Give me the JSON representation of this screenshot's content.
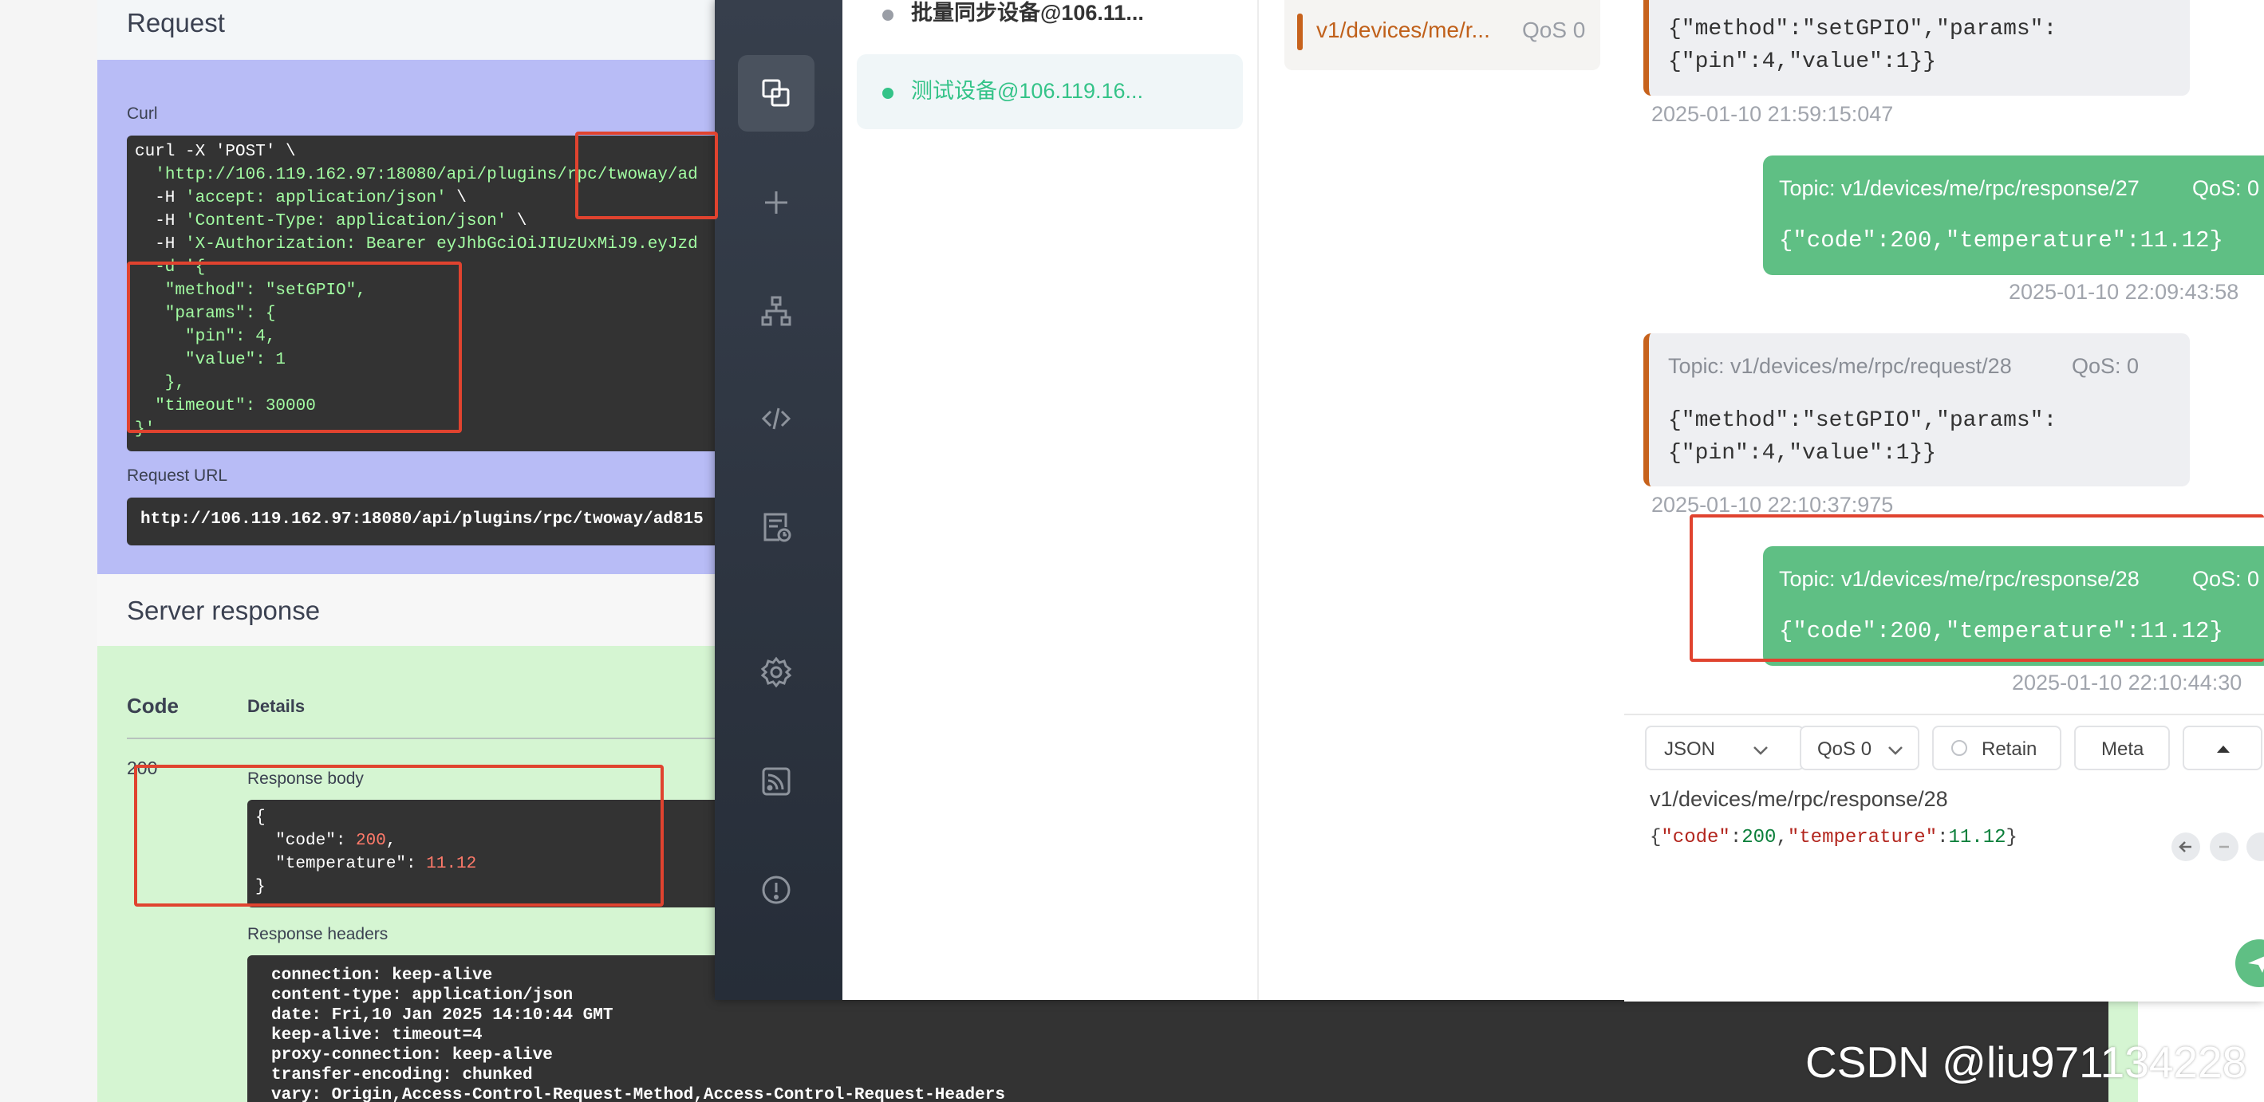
{
  "swagger": {
    "request_title": "Request",
    "curl_label": "Curl",
    "curl_lines": [
      "curl -X 'POST' \\",
      "  'http://106.119.162.97:18080/api/plugins/rpc/twoway/ad",
      "  -H 'accept: application/json' \\",
      "  -H 'Content-Type: application/json' \\",
      "  -H 'X-Authorization: Bearer eyJhbGciOiJIUzUxMiJ9.eyJzd",
      "  -d '{",
      "   \"method\": \"setGPIO\",",
      "   \"params\": {",
      "     \"pin\": 4,",
      "     \"value\": 1",
      "   },",
      "  \"timeout\": 30000",
      "}'"
    ],
    "request_url_label": "Request URL",
    "request_url": "http://106.119.162.97:18080/api/plugins/rpc/twoway/ad815",
    "server_response_title": "Server response",
    "code_header": "Code",
    "details_header": "Details",
    "code_value": "200",
    "response_body_label": "Response body",
    "response_body": {
      "open": "{",
      "code_key": "  \"code\": ",
      "code_val": "200",
      "comma": ",",
      "temp_key": "  \"temperature\": ",
      "temp_val": "11.12",
      "close": "}"
    },
    "response_headers_label": "Response headers",
    "response_headers": "connection: keep-alive\ncontent-type: application/json\ndate: Fri,10 Jan 2025 14:10:44 GMT\nkeep-alive: timeout=4\nproxy-connection: keep-alive\ntransfer-encoding: chunked\nvary: Origin,Access-Control-Request-Method,Access-Control-Request-Headers"
  },
  "mqttx": {
    "nav_icons": [
      "connections-icon",
      "plus-icon",
      "network-icon",
      "code-icon",
      "log-icon",
      "settings-icon",
      "feed-icon",
      "info-icon"
    ],
    "connections": [
      {
        "label": "批量同步设备@106.11...",
        "dot_color": "#9a9ea6",
        "text_color": "#333333"
      },
      {
        "label": "测试设备@106.119.16...",
        "dot_color": "#34c388",
        "text_color": "#34c388"
      }
    ],
    "subscription": {
      "topic": "v1/devices/me/r...",
      "qos": "QoS 0",
      "color": "#c7621c"
    },
    "messages": {
      "m1": {
        "payload": "{\"method\":\"setGPIO\",\"params\":\n{\"pin\":4,\"value\":1}}",
        "time": "2025-01-10 21:59:15:047"
      },
      "m2": {
        "topic": "Topic: v1/devices/me/rpc/response/27",
        "qos": "QoS: 0",
        "payload": "{\"code\":200,\"temperature\":11.12}",
        "time": "2025-01-10 22:09:43:58"
      },
      "m3": {
        "topic": "Topic: v1/devices/me/rpc/request/28",
        "qos": "QoS: 0",
        "payload": "{\"method\":\"setGPIO\",\"params\":\n{\"pin\":4,\"value\":1}}",
        "time": "2025-01-10 22:10:37:975"
      },
      "m4": {
        "topic": "Topic: v1/devices/me/rpc/response/28",
        "qos": "QoS: 0",
        "payload": "{\"code\":200,\"temperature\":11.12}",
        "time": "2025-01-10 22:10:44:30"
      }
    },
    "composer": {
      "format": "JSON",
      "qos": "QoS 0",
      "retain": "Retain",
      "meta": "Meta",
      "topic": "v1/devices/me/rpc/response/28",
      "payload": {
        "b1": "{",
        "k1": "\"code\"",
        "c1": ":",
        "v1": "200",
        "sep": ",",
        "k2": "\"temperature\"",
        "c2": ":",
        "v2": "11.12",
        "b2": "}"
      }
    }
  },
  "watermark": "CSDN @liu971134228"
}
